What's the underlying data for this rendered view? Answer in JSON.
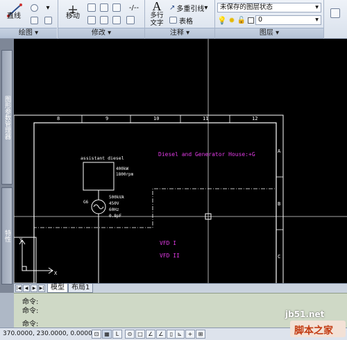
{
  "ribbon": {
    "line_label": "直线",
    "move_label": "移动",
    "multiline_text_label": "多行\n文字",
    "multileader_label": "多重引线",
    "table_label": "表格",
    "layer_state": "未保存的图层状态",
    "current_layer": "0",
    "panels": {
      "draw": "绘图",
      "modify": "修改",
      "annotation": "注释",
      "layers": "图层"
    }
  },
  "palettes": {
    "sheet_set_manager": "图形参数管理器",
    "properties": "特性"
  },
  "drawing": {
    "column_numbers": [
      "8",
      "9",
      "10",
      "11",
      "12"
    ],
    "row_letters": [
      "A",
      "B",
      "C"
    ],
    "title_text": "Diesel and Generator House:+G",
    "assistant_label": "assistant diesel",
    "engine_specs": [
      "400kW",
      "1800rpm"
    ],
    "generator_tag": "G6",
    "generator_specs": [
      "500kVA",
      "450V",
      "60Hz",
      "0.8pF"
    ],
    "vfd_labels": [
      "VFD I",
      "VFD II"
    ],
    "ucs_x": "X",
    "ucs_y": "Y"
  },
  "layout_tabs": [
    "模型",
    "布局1"
  ],
  "command": {
    "lines": [
      "命令:",
      "命令:",
      "命令:"
    ]
  },
  "status": {
    "coordinates": "370.0000, 230.0000, 0.0000"
  },
  "watermark": {
    "url": "jb51.net",
    "brand": "脚本之家"
  },
  "colors": {
    "canvas": "#000000",
    "annotation_magenta": "#e23be6",
    "linework": "#ffffff",
    "command_bg": "#cfd9c6"
  }
}
